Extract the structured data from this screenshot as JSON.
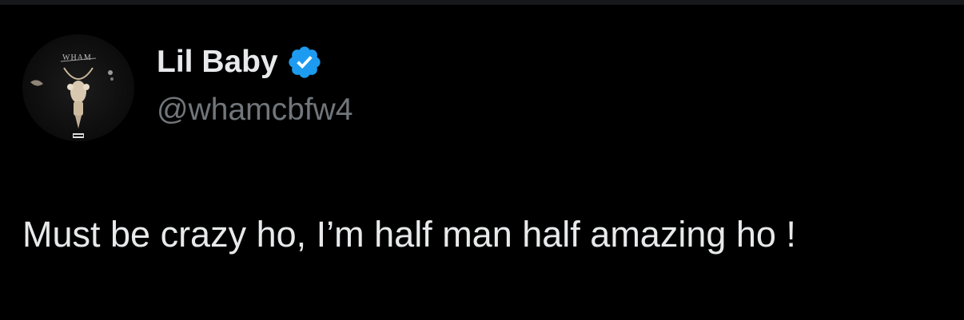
{
  "tweet": {
    "author": {
      "display_name": "Lil Baby",
      "handle": "@whamcbfw4",
      "verified": true,
      "avatar_icon": "album-cover-avatar",
      "avatar_text": "WHAM"
    },
    "text": "Must be crazy ho, I’m half man half amazing ho !"
  },
  "colors": {
    "background": "#000000",
    "name": "#e7e9ea",
    "handle": "#71767b",
    "verified_badge": "#1d9bf0"
  }
}
